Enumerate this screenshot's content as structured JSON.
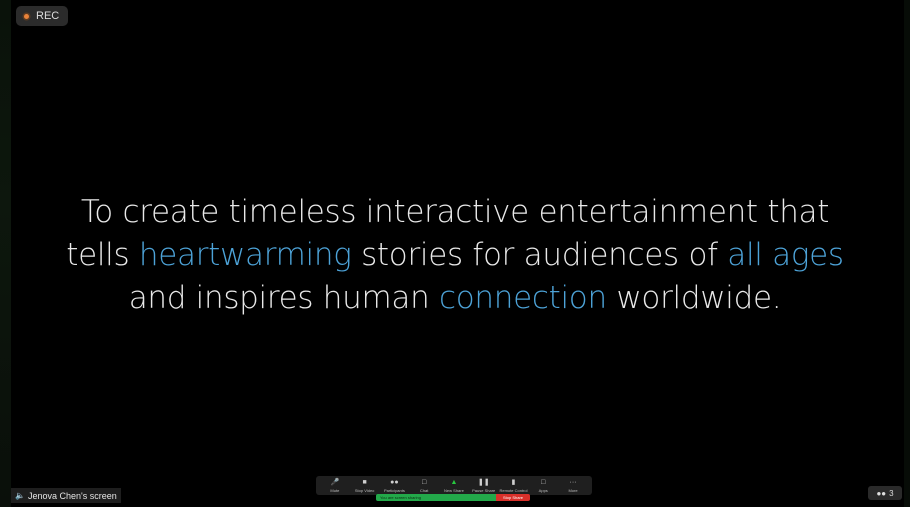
{
  "recording": {
    "label": "REC",
    "indicator_color": "#e8823a"
  },
  "slide": {
    "line1": "To create timeless interactive entertainment that",
    "line2_a": "tells ",
    "line2_hl1": "heartwarming",
    "line2_b": " stories for audiences of ",
    "line2_hl2": "all ages",
    "line3_a": "and inspires human ",
    "line3_hl": "connection",
    "line3_b": " worldwide.",
    "text_color": "#e9e9e9",
    "highlight_color": "#4da3d8"
  },
  "share_label": {
    "text": "Jenova Chen's screen",
    "icon": "speaker-icon"
  },
  "toolbar": {
    "buttons": [
      {
        "label": "Mute",
        "icon": "microphone-icon"
      },
      {
        "label": "Stop Video",
        "icon": "camera-icon"
      },
      {
        "label": "Participants",
        "icon": "participants-icon"
      },
      {
        "label": "Chat",
        "icon": "chat-icon"
      },
      {
        "label": "New Share",
        "icon": "share-screen-icon"
      },
      {
        "label": "Pause Share",
        "icon": "pause-icon"
      },
      {
        "label": "Remote Control",
        "icon": "mouse-icon"
      },
      {
        "label": "Apps",
        "icon": "apps-icon"
      },
      {
        "label": "More",
        "icon": "more-icon"
      }
    ],
    "participants_count": "3"
  },
  "sharing_bar": {
    "status": "You are screen sharing",
    "stop_label": "Stop Share",
    "status_color": "#23a94a",
    "stop_color": "#d9302a"
  },
  "participants_chip": {
    "count": "3",
    "icon": "people-icon"
  }
}
